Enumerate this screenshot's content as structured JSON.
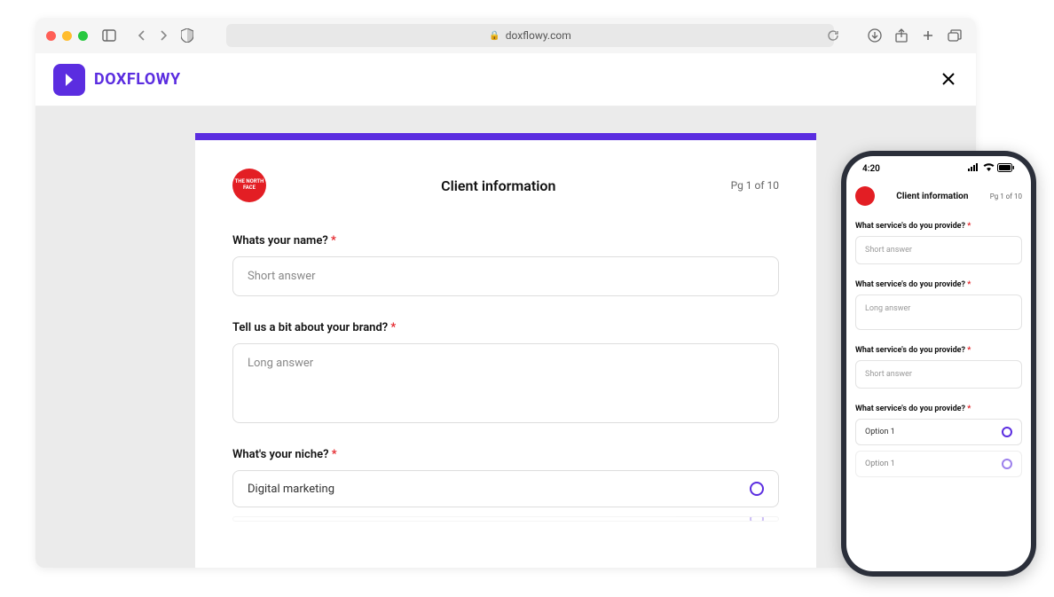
{
  "browser": {
    "url": "doxflowy.com"
  },
  "app": {
    "name": "DOXFLOWY"
  },
  "form": {
    "title": "Client information",
    "pageCounter": "Pg 1 of 10",
    "brandText": "THE NORTH FACE",
    "questions": [
      {
        "label": "Whats your name?",
        "placeholder": "Short answer"
      },
      {
        "label": "Tell us a bit about your brand?",
        "placeholder": "Long answer"
      },
      {
        "label": "What's your niche?",
        "option": "Digital marketing"
      }
    ]
  },
  "mobile": {
    "time": "4:20",
    "title": "Client information",
    "pageCounter": "Pg 1 of 10",
    "questions": [
      {
        "label": "What service's do you provide?",
        "placeholder": "Short answer"
      },
      {
        "label": "What service's do you provide?",
        "placeholder": "Long answer"
      },
      {
        "label": "What service's do you provide?",
        "placeholder": "Short answer"
      },
      {
        "label": "What service's do you provide?",
        "option1": "Option 1",
        "option2": "Option 1"
      }
    ]
  }
}
